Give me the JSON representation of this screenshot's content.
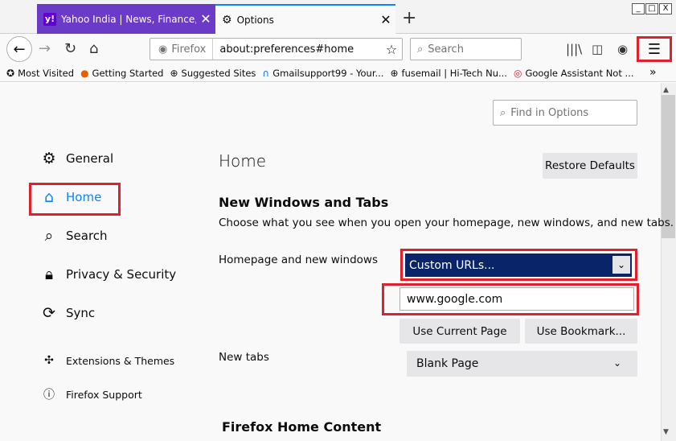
{
  "tabs": [
    {
      "label": "Yahoo India | News, Finance, Cric",
      "favicon": "y!"
    },
    {
      "label": "Options"
    }
  ],
  "window": {
    "min": "_",
    "max": "□",
    "close": "X"
  },
  "nav": {
    "url_identity": "Firefox",
    "url": "about:preferences#home",
    "search_placeholder": "Search"
  },
  "bookmarks": [
    {
      "label": "Most Visited",
      "icon": "star-icon"
    },
    {
      "label": "Getting Started",
      "icon": "firefox-icon"
    },
    {
      "label": "Suggested Sites",
      "icon": "globe-icon"
    },
    {
      "label": "Gmailsupport99 - Your...",
      "icon": "headset-icon"
    },
    {
      "label": "fusemail | Hi-Tech Nu...",
      "icon": "globe-icon"
    },
    {
      "label": "Google Assistant Not ...",
      "icon": "target-icon"
    }
  ],
  "find_placeholder": "Find in Options",
  "categories": {
    "general": "General",
    "home": "Home",
    "search": "Search",
    "privacy": "Privacy & Security",
    "sync": "Sync",
    "extensions": "Extensions & Themes",
    "support": "Firefox Support"
  },
  "pane": {
    "title": "Home",
    "restore": "Restore Defaults",
    "section_title": "New Windows and Tabs",
    "section_desc": "Choose what you see when you open your homepage, new windows, and new tabs.",
    "hp_label": "Homepage and new windows",
    "hp_select": "Custom URLs...",
    "hp_url": "www.google.com",
    "use_current": "Use Current Page",
    "use_bookmark": "Use Bookmark...",
    "newtabs_label": "New tabs",
    "newtabs_select": "Blank Page",
    "home_content_title": "Firefox Home Content"
  },
  "colors": {
    "accent": "#0a84ff",
    "highlight": "#e0202d",
    "select_bg": "#0a246a"
  }
}
